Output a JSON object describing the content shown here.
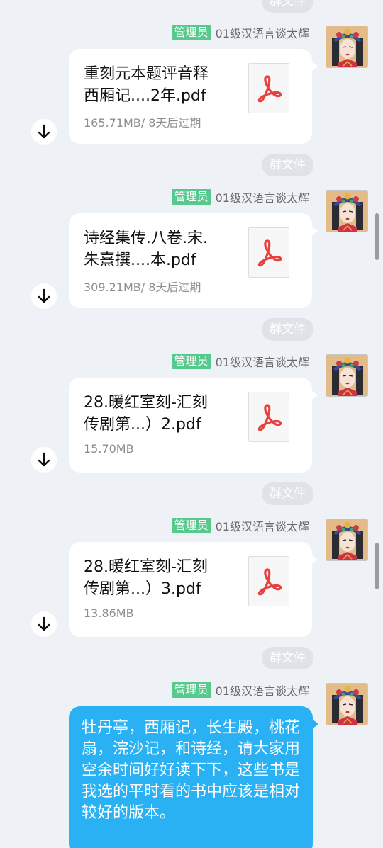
{
  "group_file_tag": "群文件",
  "admin_badge": "管理员",
  "sender_name": "01级汉语言谈太辉",
  "messages": [
    {
      "type": "file",
      "name": "重刻元本题评音释\n西厢记....2年.pdf",
      "meta": "165.71MB/ 8天后过期",
      "file_icon": "pdf-icon",
      "action_icon": "download-arrow-icon"
    },
    {
      "type": "file",
      "name": "诗经集传.八卷.宋.\n朱熹撰....本.pdf",
      "meta": "309.21MB/ 8天后过期",
      "file_icon": "pdf-icon",
      "action_icon": "download-arrow-icon"
    },
    {
      "type": "file",
      "name": "28.暖红室刻-汇刻\n传剧第...）2.pdf",
      "meta": "15.70MB",
      "file_icon": "pdf-icon",
      "action_icon": "download-arrow-icon"
    },
    {
      "type": "file",
      "name": "28.暖红室刻-汇刻\n传剧第...）3.pdf",
      "meta": "13.86MB",
      "file_icon": "pdf-icon",
      "action_icon": "download-arrow-icon"
    },
    {
      "type": "text",
      "text": "牡丹亭，西厢记，长生殿，桃花扇，浣沙记，和诗经，请大家用空余时间好好读下下，这些书是我选的平时看的书中应该是相对较好的版本。"
    }
  ],
  "colors": {
    "background": "#eef1f5",
    "admin_badge": "#58c98c",
    "text_bubble": "#29b1f3",
    "pdf_red": "#e8403f",
    "tag_bg": "#dfe3e8"
  }
}
